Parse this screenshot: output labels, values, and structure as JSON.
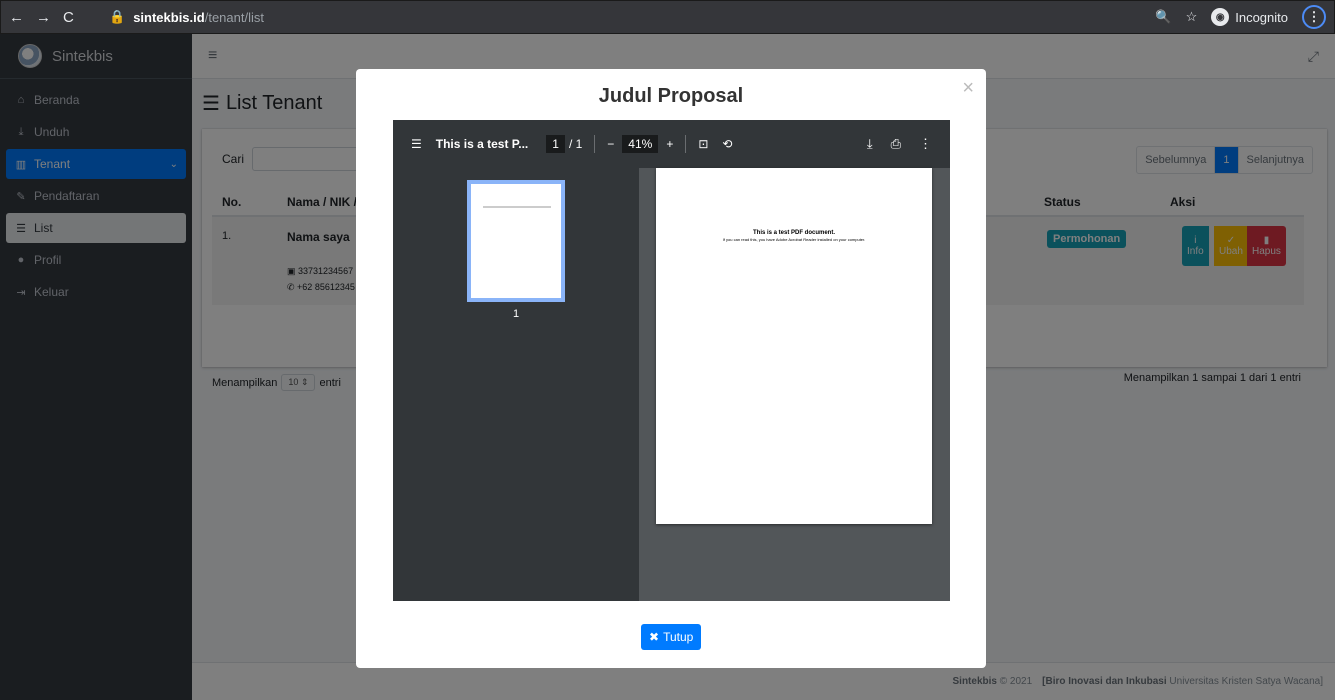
{
  "browser": {
    "url_host": "sintekbis.id",
    "url_path": "/tenant/list",
    "incognito_label": "Incognito"
  },
  "sidebar": {
    "brand": "Sintekbis",
    "items": [
      {
        "label": "Beranda",
        "icon": "home-icon"
      },
      {
        "label": "Unduh",
        "icon": "download-icon"
      },
      {
        "label": "Tenant",
        "icon": "building-icon"
      },
      {
        "label": "Pendaftaran",
        "icon": "edit-icon"
      },
      {
        "label": "List",
        "icon": "list-icon"
      },
      {
        "label": "Profil",
        "icon": "user-icon"
      },
      {
        "label": "Keluar",
        "icon": "logout-icon"
      }
    ]
  },
  "page": {
    "title": "List Tenant",
    "search_label": "Cari",
    "pagination": {
      "prev": "Sebelumnya",
      "current": "1",
      "next": "Selanjutnya"
    },
    "columns": {
      "no": "No.",
      "name": "Nama / NIK /",
      "status": "Status",
      "aksi": "Aksi"
    },
    "row": {
      "no": "1.",
      "name": "Nama saya",
      "nik": "33731234567",
      "phone": "+62 85612345",
      "status": "Permohonan",
      "actions": {
        "info": "Info",
        "ubah": "Ubah",
        "hapus": "Hapus"
      }
    },
    "length_label_prefix": "Menampilkan",
    "length_value": "10",
    "length_label_suffix": "entri",
    "info_text": "Menampilkan 1 sampai 1 dari 1 entri"
  },
  "footer": {
    "brand": "Sintekbis",
    "year": "© 2021",
    "org_bold": "[Biro Inovasi dan Inkubasi",
    "org_rest": "Universitas Kristen Satya Wacana]"
  },
  "modal": {
    "title": "Judul Proposal",
    "close_button": "Tutup",
    "viewer": {
      "doc_title": "This is a test P...",
      "page_current": "1",
      "page_total": "/ 1",
      "zoom": "41%",
      "thumb_page": "1",
      "doc_heading": "This is a test PDF document.",
      "doc_sub": "If you can read this, you have Adobe Acrobat Reader installed on your computer."
    }
  }
}
